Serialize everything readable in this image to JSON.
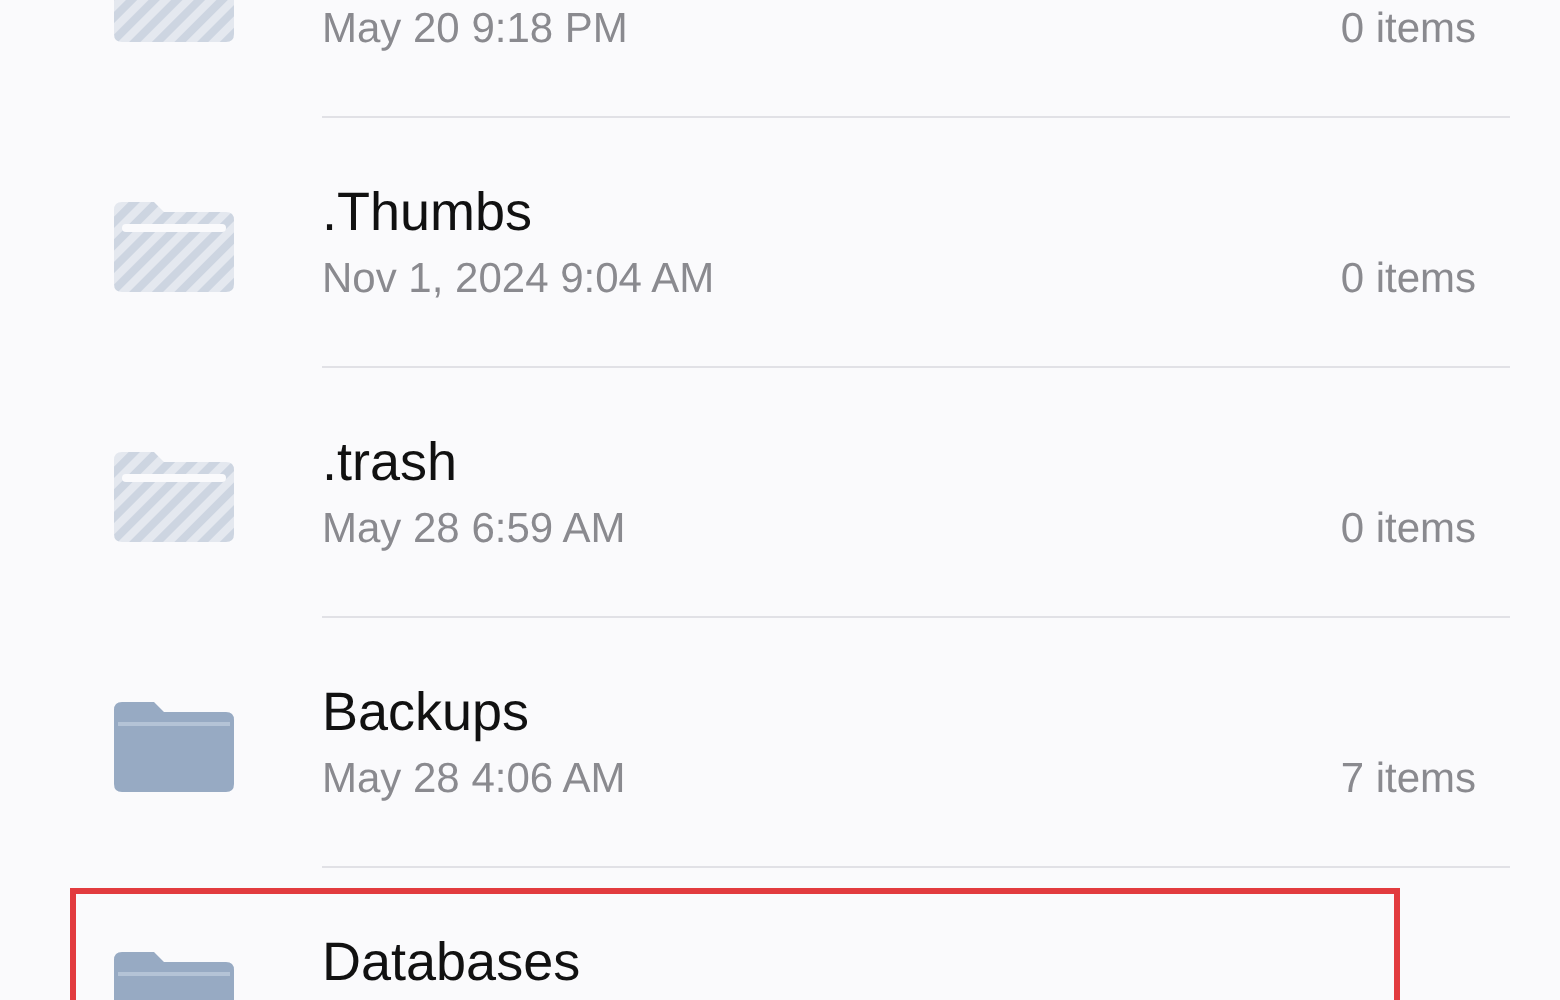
{
  "items": [
    {
      "dimmed": true,
      "highlighted": false,
      "modified": "May 20 9:18 PM",
      "count": "0 items"
    },
    {
      "name": ".Thumbs",
      "dimmed": true,
      "highlighted": false,
      "modified": "Nov 1, 2024 9:04 AM",
      "count": "0 items"
    },
    {
      "name": ".trash",
      "dimmed": true,
      "highlighted": false,
      "modified": "May 28 6:59 AM",
      "count": "0 items"
    },
    {
      "name": "Backups",
      "dimmed": false,
      "highlighted": false,
      "modified": "May 28 4:06 AM",
      "count": "7 items"
    },
    {
      "name": "Databases",
      "dimmed": false,
      "highlighted": true
    }
  ]
}
